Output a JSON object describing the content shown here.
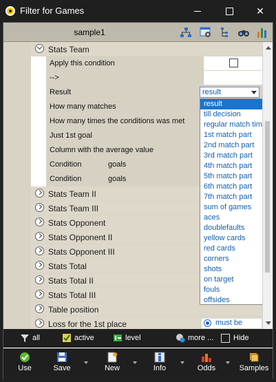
{
  "window": {
    "title": "Filter for Games"
  },
  "header": {
    "title": "sample1"
  },
  "tree": {
    "expanded_category": "Stats Team",
    "children": [
      {
        "label": "Apply this condition",
        "value": ""
      },
      {
        "label": "-->",
        "value": ""
      },
      {
        "label": "Result",
        "value": ""
      },
      {
        "label": "How many matches",
        "value": ""
      },
      {
        "label": "How many times the conditions was met",
        "value": ""
      },
      {
        "label": "Just 1st goal",
        "value": ""
      },
      {
        "label": "Column with the average value",
        "value": ""
      },
      {
        "label": "Condition",
        "value": "goals"
      },
      {
        "label": "Condition",
        "value": "goals"
      }
    ],
    "categories": [
      "Stats Team II",
      "Stats Team III",
      "Stats Opponent",
      "Stats Opponent II",
      "Stats Opponent III",
      "Stats Total",
      "Stats Total II",
      "Stats Total III",
      "Table position",
      "Loss for the 1st place"
    ],
    "result_select": {
      "selected": "result",
      "options": [
        "result",
        "till decision",
        "regular match time",
        "1st match part",
        "2nd match part",
        "3rd match part",
        "4th match part",
        "5th match part",
        "6th match part",
        "7th match part",
        "sum of games",
        "aces",
        "doublefaults",
        "yellow cards",
        "red cards",
        "corners",
        "shots",
        "on target",
        "fouls",
        "offsides"
      ]
    },
    "radio_label": "must be"
  },
  "filterbar": {
    "all": "all",
    "active": "active",
    "level": "level",
    "more": "more ...",
    "hide": "Hide"
  },
  "toolbar": {
    "use": "Use",
    "save": "Save",
    "new": "New",
    "info": "Info",
    "odds": "Odds",
    "samples": "Samples"
  },
  "colors": {
    "accent": "#1874d1",
    "dropdown_text": "#0f5fb0",
    "panel": "#d6d1c3",
    "titlebar": "#1f1f1f"
  }
}
